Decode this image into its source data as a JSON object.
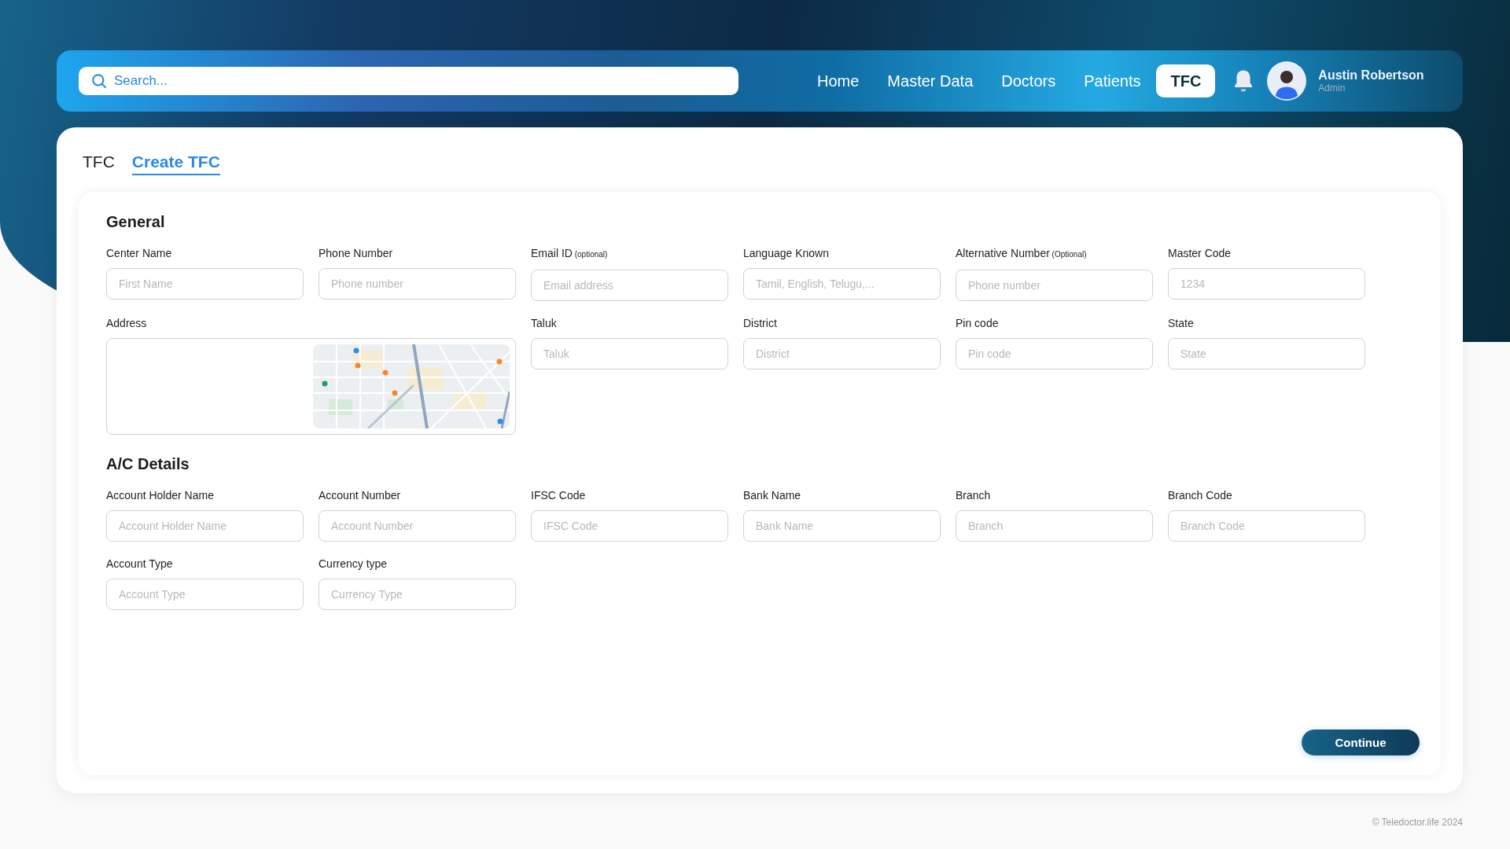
{
  "header": {
    "search": {
      "placeholder": "Search..."
    },
    "nav": [
      {
        "label": "Home",
        "selected": false
      },
      {
        "label": "Master Data",
        "selected": false
      },
      {
        "label": "Doctors",
        "selected": false
      },
      {
        "label": "Patients",
        "selected": false
      },
      {
        "label": "TFC",
        "selected": true
      }
    ],
    "user": {
      "name": "Austin Robertson",
      "role": "Admin"
    }
  },
  "tabs": [
    {
      "label": "TFC",
      "selected": false
    },
    {
      "label": "Create TFC",
      "selected": true
    }
  ],
  "sections": [
    {
      "title": "General",
      "fields": [
        {
          "kind": "text",
          "label": "Center Name",
          "placeholder": "First Name"
        },
        {
          "kind": "text",
          "label": "Phone Number",
          "placeholder": "Phone number"
        },
        {
          "kind": "text",
          "label": "Email ID",
          "note": "(optional)",
          "placeholder": "Email address"
        },
        {
          "kind": "text",
          "label": "Language Known",
          "placeholder": "Tamil, English, Telugu,..."
        },
        {
          "kind": "text",
          "label": "Alternative Number",
          "note": "(Optional)",
          "placeholder": "Phone number"
        },
        {
          "kind": "text",
          "label": "Master Code",
          "placeholder": "1234"
        },
        {
          "kind": "address",
          "label": "Address"
        },
        {
          "kind": "text",
          "label": "Taluk",
          "placeholder": "Taluk"
        },
        {
          "kind": "text",
          "label": "District",
          "placeholder": "District"
        },
        {
          "kind": "text",
          "label": "Pin code",
          "placeholder": "Pin code"
        },
        {
          "kind": "text",
          "label": "State",
          "placeholder": "State"
        }
      ]
    },
    {
      "title": "A/C Details",
      "fields": [
        {
          "kind": "text",
          "label": "Account Holder Name",
          "placeholder": "Account Holder Name"
        },
        {
          "kind": "text",
          "label": "Account Number",
          "placeholder": "Account Number"
        },
        {
          "kind": "text",
          "label": "IFSC Code",
          "placeholder": "IFSC Code"
        },
        {
          "kind": "text",
          "label": "Bank Name",
          "placeholder": "Bank Name"
        },
        {
          "kind": "text",
          "label": "Branch",
          "placeholder": "Branch"
        },
        {
          "kind": "text",
          "label": "Branch Code",
          "placeholder": "Branch Code"
        },
        {
          "kind": "text",
          "label": "Account Type",
          "placeholder": "Account Type"
        },
        {
          "kind": "text",
          "label": "Currency type",
          "placeholder": "Currency Type"
        }
      ]
    }
  ],
  "continue_button": "Continue",
  "footer": "© Teledoctor.life 2024"
}
